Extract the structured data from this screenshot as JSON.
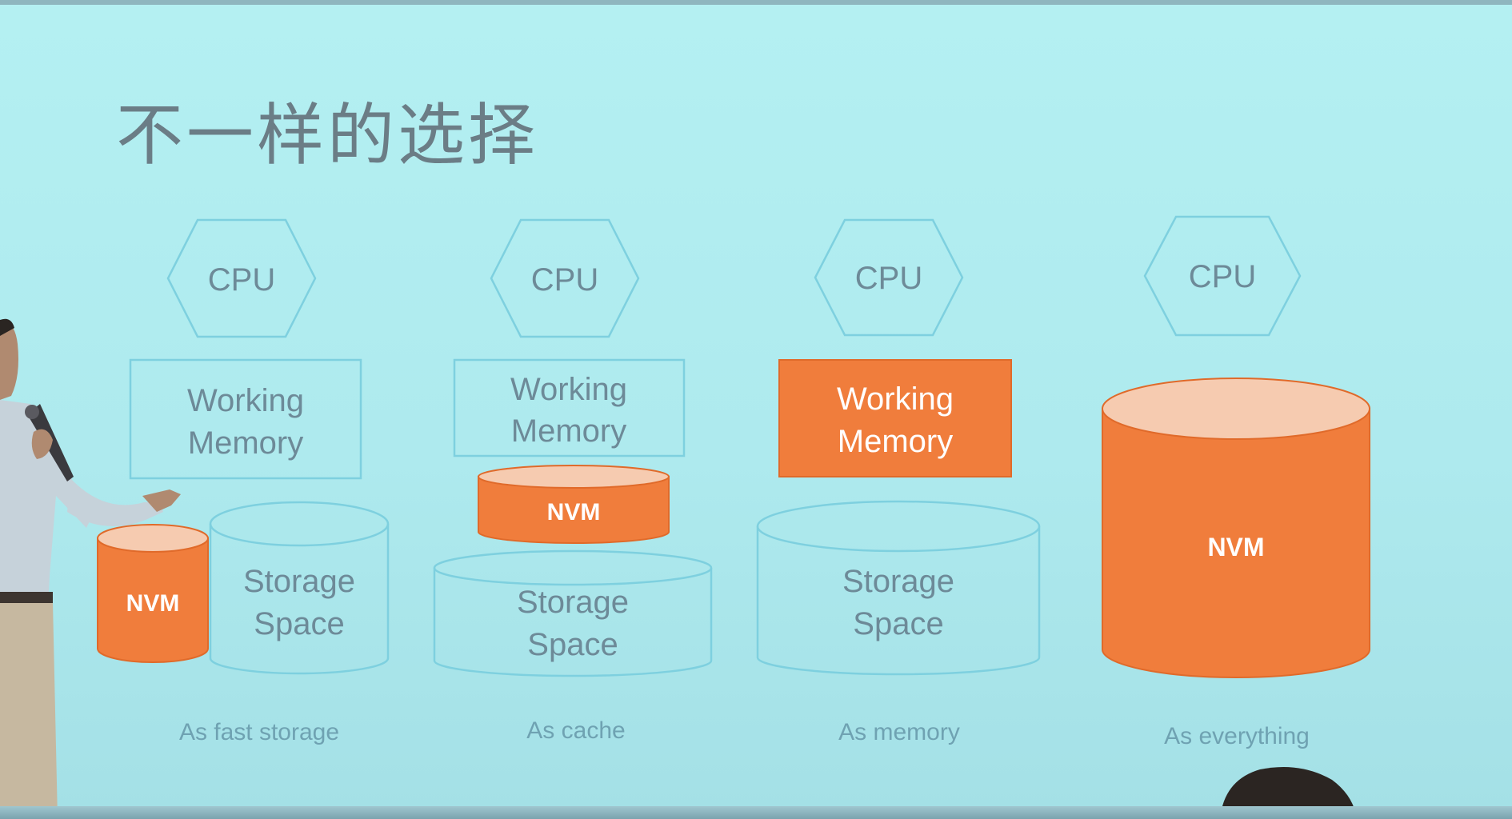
{
  "slide": {
    "title": "不一样的选择"
  },
  "labels": {
    "cpu": "CPU",
    "working_memory_line1": "Working",
    "working_memory_line2": "Memory",
    "storage_line1": "Storage",
    "storage_line2": "Space",
    "nvm": "NVM"
  },
  "captions": [
    "As fast storage",
    "As cache",
    "As memory",
    "As everything"
  ],
  "colors": {
    "background": "#b4f0f2",
    "outline": "#7ed0df",
    "nvm_orange": "#f07d3c",
    "text_gray": "#6d8a98"
  }
}
